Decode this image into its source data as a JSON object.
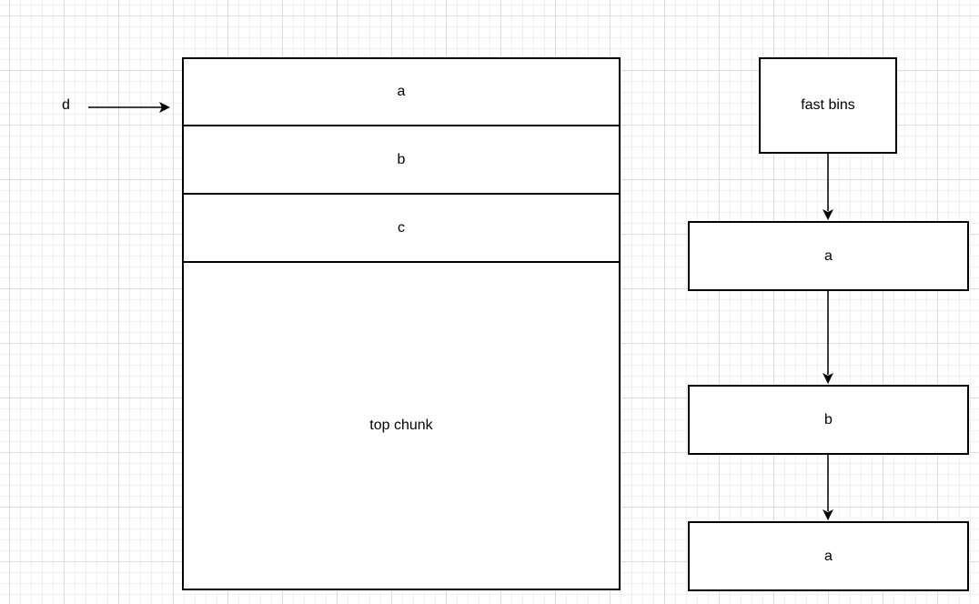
{
  "heap": {
    "chunks": [
      {
        "label": "a"
      },
      {
        "label": "b"
      },
      {
        "label": "c"
      },
      {
        "label": "top chunk"
      }
    ]
  },
  "pointer": {
    "label": "d"
  },
  "fastbins": {
    "header": "fast bins",
    "entries": [
      {
        "label": "a"
      },
      {
        "label": "b"
      },
      {
        "label": "a"
      }
    ]
  }
}
